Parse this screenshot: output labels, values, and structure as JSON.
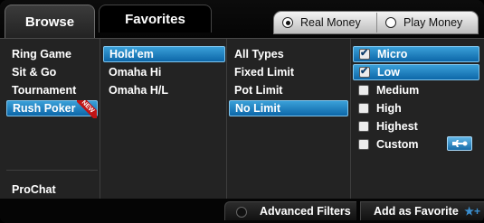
{
  "tabs": {
    "browse": "Browse",
    "favorites": "Favorites"
  },
  "money": {
    "real": "Real Money",
    "play": "Play Money",
    "selected": "real"
  },
  "game_types": [
    {
      "label": "Ring Game",
      "selected": false
    },
    {
      "label": "Sit & Go",
      "selected": false
    },
    {
      "label": "Tournament",
      "selected": false
    },
    {
      "label": "Rush Poker",
      "selected": true,
      "badge": "NEW"
    }
  ],
  "prochat": "ProChat",
  "games": [
    {
      "label": "Hold'em",
      "selected": true
    },
    {
      "label": "Omaha Hi",
      "selected": false
    },
    {
      "label": "Omaha H/L",
      "selected": false
    }
  ],
  "limits": [
    {
      "label": "All Types",
      "selected": false
    },
    {
      "label": "Fixed Limit",
      "selected": false
    },
    {
      "label": "Pot Limit",
      "selected": false
    },
    {
      "label": "No Limit",
      "selected": true
    }
  ],
  "stakes": [
    {
      "label": "Micro",
      "checked": true,
      "selected": true
    },
    {
      "label": "Low",
      "checked": true,
      "selected": true
    },
    {
      "label": "Medium",
      "checked": false,
      "selected": false
    },
    {
      "label": "High",
      "checked": false,
      "selected": false
    },
    {
      "label": "Highest",
      "checked": false,
      "selected": false
    },
    {
      "label": "Custom",
      "checked": false,
      "selected": false,
      "tool": "wrench-icon"
    }
  ],
  "footer": {
    "advanced": "Advanced Filters",
    "favorite": "Add as Favorite",
    "favorite_icon": "star-plus-icon"
  },
  "colors": {
    "selection": "#1a7fc1",
    "background": "#232323"
  }
}
